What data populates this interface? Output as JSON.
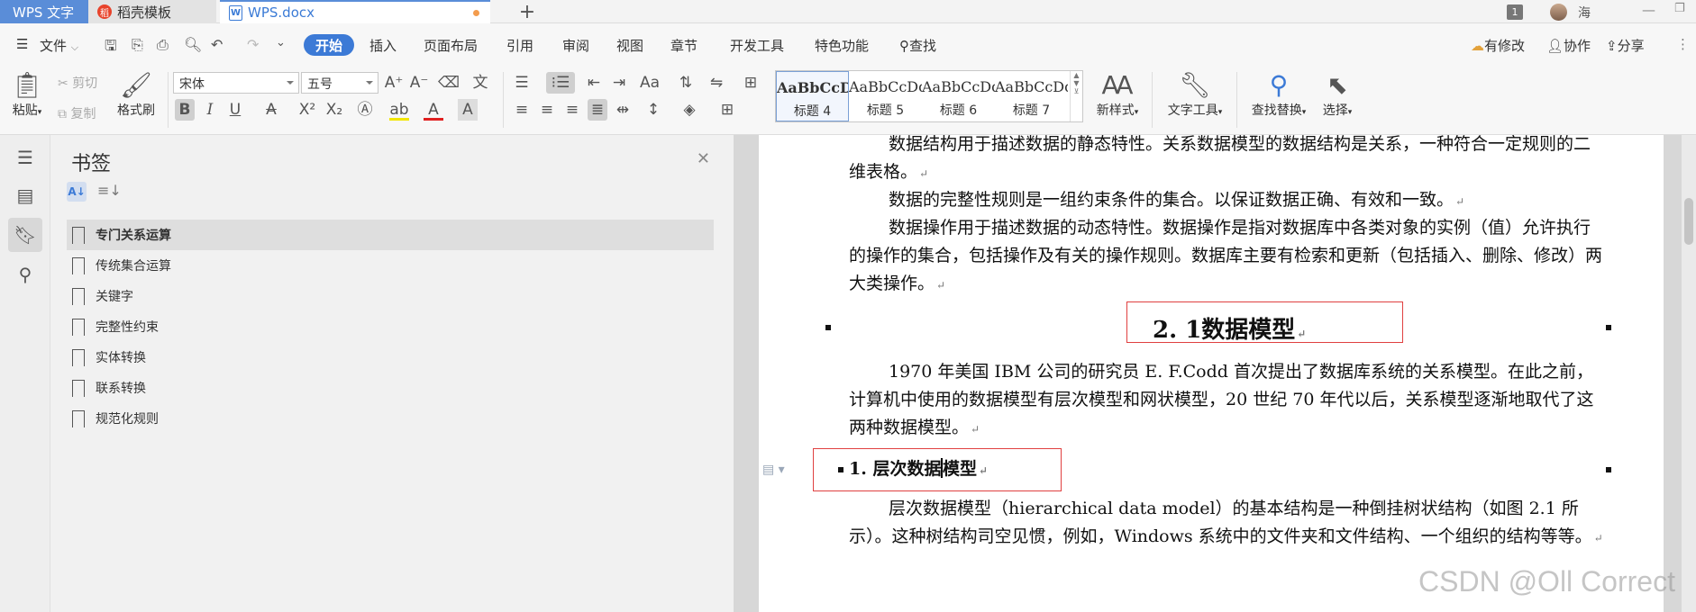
{
  "titlebar": {
    "tabs": [
      {
        "label": "WPS 文字"
      },
      {
        "label": "稻壳模板"
      },
      {
        "label": "WPS.docx"
      }
    ],
    "window_count": "1",
    "user": "海"
  },
  "menubar": {
    "file": "文件",
    "items": [
      "开始",
      "插入",
      "页面布局",
      "引用",
      "审阅",
      "视图",
      "章节",
      "开发工具",
      "特色功能"
    ],
    "search": "查找",
    "right": [
      "有修改",
      "协作",
      "分享"
    ]
  },
  "ribbon": {
    "paste": "粘贴",
    "cut": "剪切",
    "copy": "复制",
    "format_painter": "格式刷",
    "font_name": "宋体",
    "font_size": "五号",
    "styles": [
      {
        "preview": "AaBbCcDd",
        "name": "标题 4"
      },
      {
        "preview": "AaBbCcDd",
        "name": "标题 5"
      },
      {
        "preview": "AaBbCcDd",
        "name": "标题 6"
      },
      {
        "preview": "AaBbCcDd",
        "name": "标题 7"
      }
    ],
    "new_style": "新样式",
    "text_tools": "文字工具",
    "find_replace": "查找替换",
    "select": "选择"
  },
  "bookmarks": {
    "title": "书签",
    "items": [
      "专门关系运算",
      "传统集合运算",
      "关键字",
      "完整性约束",
      "实体转换",
      "联系转换",
      "规范化规则"
    ]
  },
  "document": {
    "p1": "数据结构用于描述数据的静态特性。关系数据模型的数据结构是关系，一种符合一定规则的二维表格。",
    "p2": "数据的完整性规则是一组约束条件的集合。以保证数据正确、有效和一致。",
    "p3": "数据操作用于描述数据的动态特性。数据操作是指对数据库中各类对象的实例（值）允许执行的操作的集合，包括操作及有关的操作规则。数据库主要有检索和更新（包括插入、删除、修改）两大类操作。",
    "h2": "2. 1数据模型",
    "p4": "1970 年美国 IBM 公司的研究员 E. F.Codd 首次提出了数据库系统的关系模型。在此之前，计算机中使用的数据模型有层次模型和网状模型，20 世纪 70 年代以后，关系模型逐渐地取代了这两种数据模型。",
    "h3_a": "1. 层次数据",
    "h3_b": "模型",
    "p5": "层次数据模型（hierarchical data model）的基本结构是一种倒挂树状结构（如图 2.1 所示）。这种树结构司空见惯，例如，Windows 系统中的文件夹和文件结构、一个组织的结构等等。"
  },
  "watermark": "CSDN @Oll Correct"
}
